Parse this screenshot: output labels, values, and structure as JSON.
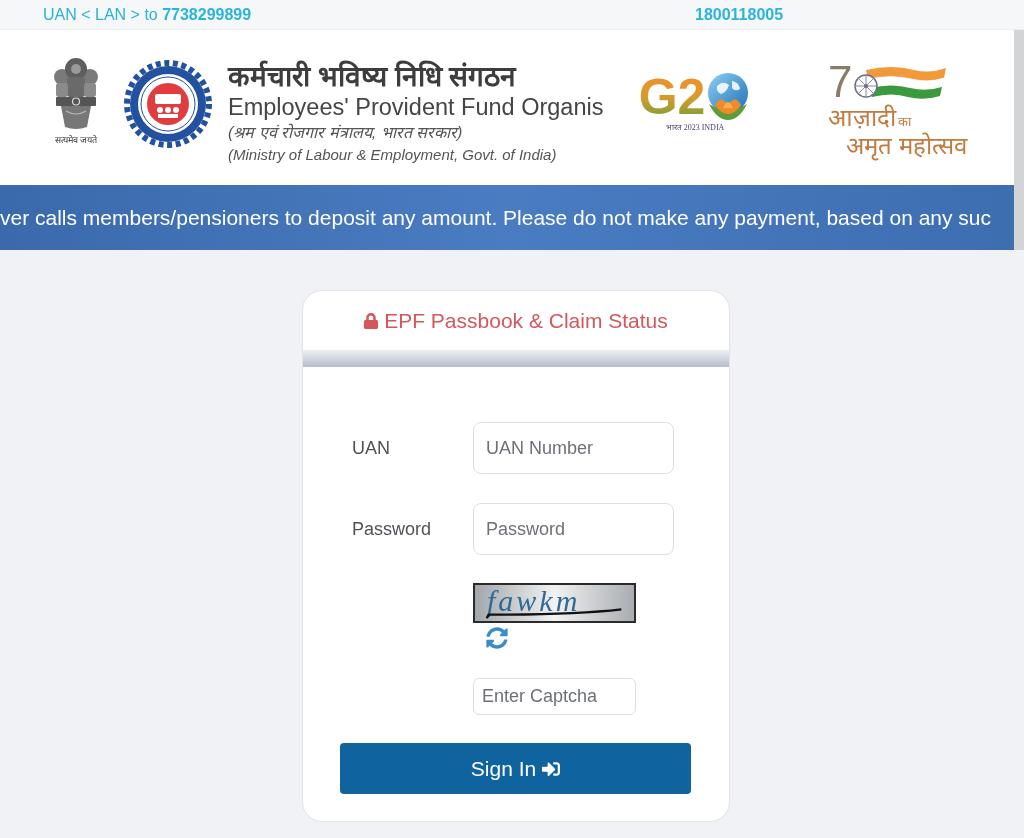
{
  "top_bar": {
    "sms_info": "UAN < LAN > to **7738299899**",
    "toll_free": "1800118005"
  },
  "header": {
    "emblem_motto": "सत्यमेव जयते",
    "title_hindi": "कर्मचारी भविष्य निधि संगठन",
    "title_english": "Employees' Provident Fund Organis",
    "ministry_hindi": "(श्रम एवं रोजगार मंत्रालय, भारत सरकार)",
    "ministry_english": "(Ministry of Labour & Employment, Govt. of India)",
    "g20_logo": {
      "letters": "G2",
      "caption": "भारत 2023 INDIA"
    },
    "azadi_logo": {
      "numeral": "7",
      "line_1": "आज़ादी",
      "line_1_suffix": "का",
      "line_2": "अमृत महोत्सव"
    }
  },
  "notice_banner": "ver calls members/pensioners to deposit any amount. Please do not make any payment, based on any suc",
  "login_card": {
    "title": "EPF Passbook & Claim Status",
    "fields": [
      {
        "label": "UAN",
        "placeholder": "UAN Number"
      },
      {
        "label": "Password",
        "placeholder": "Password"
      }
    ],
    "captcha": {
      "text": "fawkm",
      "placeholder": "Enter Captcha"
    },
    "submit_button": "Sign In"
  }
}
